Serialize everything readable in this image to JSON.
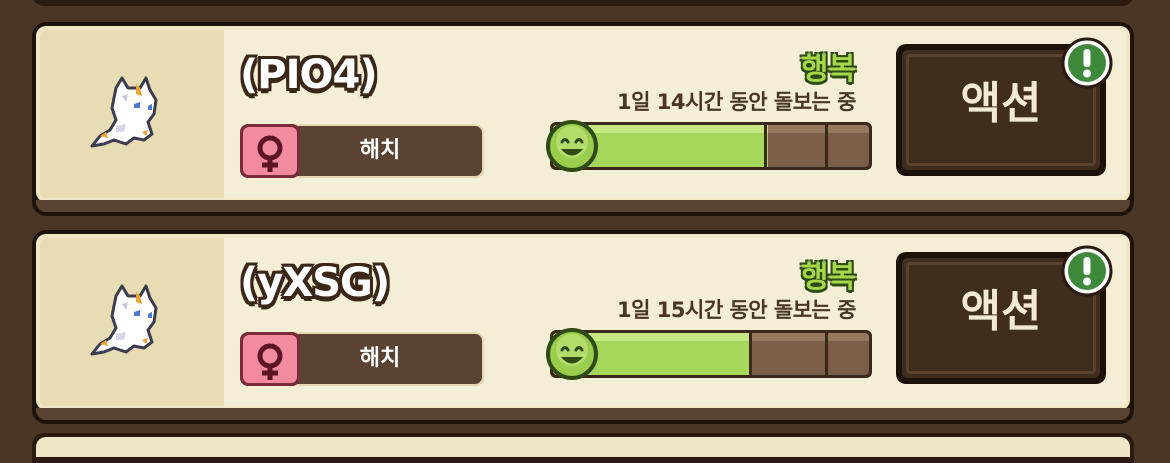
{
  "pets": [
    {
      "name": "(PIO4)",
      "gender_icon": "female-icon",
      "stage": "해치",
      "mood": "행복",
      "care_time": "1일 14시간 동안 돌보는 중",
      "happiness": 0.68,
      "action_label": "액션",
      "alert_icon": "exclamation-icon"
    },
    {
      "name": "(yXSG)",
      "gender_icon": "female-icon",
      "stage": "해치",
      "mood": "행복",
      "care_time": "1일 15시간 동안 돌보는 중",
      "happiness": 0.63,
      "action_label": "액션",
      "alert_icon": "exclamation-icon"
    }
  ],
  "colors": {
    "mood_green": "#a6d84a",
    "bar_fill": "#a6d65a",
    "female_badge": "#f28aa0",
    "card_bg": "#f5eed6",
    "button_bg": "#3f2d1e",
    "alert_green": "#3e8a3a"
  }
}
